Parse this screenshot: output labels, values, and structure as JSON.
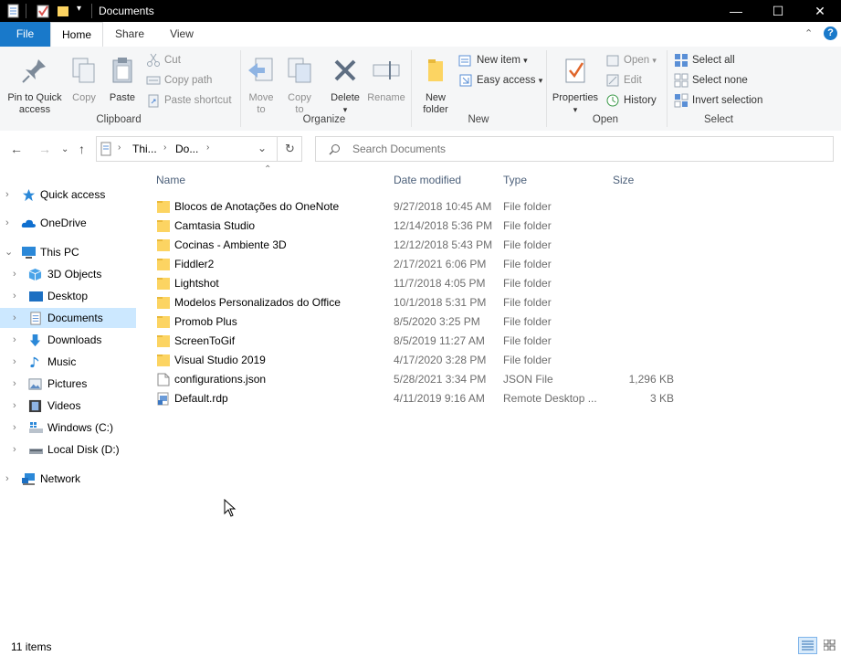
{
  "window": {
    "title": "Documents"
  },
  "tabs": {
    "file": "File",
    "home": "Home",
    "share": "Share",
    "view": "View"
  },
  "ribbon": {
    "clipboard": {
      "label": "Clipboard",
      "pin_line1": "Pin to Quick",
      "pin_line2": "access",
      "copy": "Copy",
      "paste": "Paste",
      "cut": "Cut",
      "copy_path": "Copy path",
      "paste_shortcut": "Paste shortcut"
    },
    "organize": {
      "label": "Organize",
      "move_line1": "Move",
      "move_line2": "to",
      "copy_line1": "Copy",
      "copy_line2": "to",
      "delete": "Delete",
      "rename": "Rename"
    },
    "new": {
      "label": "New",
      "new_folder_line1": "New",
      "new_folder_line2": "folder",
      "new_item": "New item",
      "easy_access": "Easy access"
    },
    "open": {
      "label": "Open",
      "properties": "Properties",
      "open": "Open",
      "edit": "Edit",
      "history": "History"
    },
    "select": {
      "label": "Select",
      "select_all": "Select all",
      "select_none": "Select none",
      "invert_selection": "Invert selection"
    }
  },
  "address": {
    "crumbs": [
      "Thi...",
      "Do..."
    ]
  },
  "search": {
    "placeholder": "Search Documents"
  },
  "nav": {
    "quick_access": "Quick access",
    "onedrive": "OneDrive",
    "this_pc": "This PC",
    "objects3d": "3D Objects",
    "desktop": "Desktop",
    "documents": "Documents",
    "downloads": "Downloads",
    "music": "Music",
    "pictures": "Pictures",
    "videos": "Videos",
    "windows_c": "Windows (C:)",
    "local_d": "Local Disk (D:)",
    "network": "Network"
  },
  "columns": {
    "name": "Name",
    "date": "Date modified",
    "type": "Type",
    "size": "Size"
  },
  "files": [
    {
      "name": "Blocos de Anotações do OneNote",
      "date": "9/27/2018 10:45 AM",
      "type": "File folder",
      "size": "",
      "kind": "folder"
    },
    {
      "name": "Camtasia Studio",
      "date": "12/14/2018 5:36 PM",
      "type": "File folder",
      "size": "",
      "kind": "folder"
    },
    {
      "name": "Cocinas - Ambiente 3D",
      "date": "12/12/2018 5:43 PM",
      "type": "File folder",
      "size": "",
      "kind": "folder"
    },
    {
      "name": "Fiddler2",
      "date": "2/17/2021 6:06 PM",
      "type": "File folder",
      "size": "",
      "kind": "folder"
    },
    {
      "name": "Lightshot",
      "date": "11/7/2018 4:05 PM",
      "type": "File folder",
      "size": "",
      "kind": "folder"
    },
    {
      "name": "Modelos Personalizados do Office",
      "date": "10/1/2018 5:31 PM",
      "type": "File folder",
      "size": "",
      "kind": "folder"
    },
    {
      "name": "Promob Plus",
      "date": "8/5/2020 3:25 PM",
      "type": "File folder",
      "size": "",
      "kind": "folder"
    },
    {
      "name": "ScreenToGif",
      "date": "8/5/2019 11:27 AM",
      "type": "File folder",
      "size": "",
      "kind": "folder"
    },
    {
      "name": "Visual Studio 2019",
      "date": "4/17/2020 3:28 PM",
      "type": "File folder",
      "size": "",
      "kind": "folder"
    },
    {
      "name": "configurations.json",
      "date": "5/28/2021 3:34 PM",
      "type": "JSON File",
      "size": "1,296 KB",
      "kind": "file"
    },
    {
      "name": "Default.rdp",
      "date": "4/11/2019 9:16 AM",
      "type": "Remote Desktop ...",
      "size": "3 KB",
      "kind": "rdp"
    }
  ],
  "status": {
    "count": "11 items"
  },
  "colors": {
    "file_tab": "#1979ca",
    "selected_nav": "#cce8ff",
    "folder": "#fcd462",
    "header_text": "#4c607a"
  }
}
